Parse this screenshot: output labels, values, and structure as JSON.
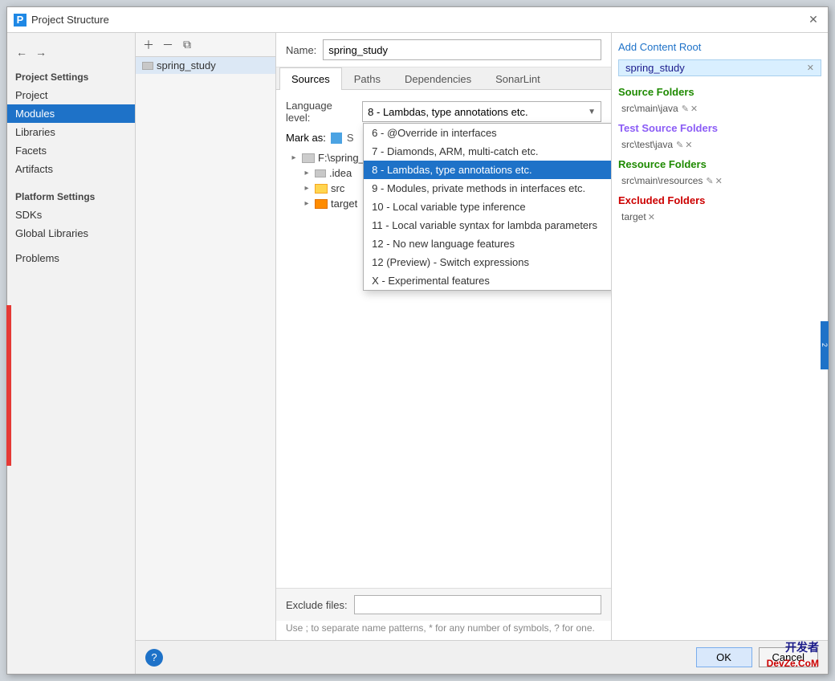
{
  "window": {
    "title": "Project Structure",
    "icon": "P"
  },
  "sidebar": {
    "project_settings_label": "Project Settings",
    "items": [
      {
        "label": "Project",
        "id": "project"
      },
      {
        "label": "Modules",
        "id": "modules",
        "active": true
      },
      {
        "label": "Libraries",
        "id": "libraries"
      },
      {
        "label": "Facets",
        "id": "facets"
      },
      {
        "label": "Artifacts",
        "id": "artifacts"
      }
    ],
    "platform_settings_label": "Platform Settings",
    "platform_items": [
      {
        "label": "SDKs",
        "id": "sdks"
      },
      {
        "label": "Global Libraries",
        "id": "global-libraries"
      }
    ],
    "other_items": [
      {
        "label": "Problems",
        "id": "problems"
      }
    ]
  },
  "module_pane": {
    "module_name": "spring_study"
  },
  "name_row": {
    "label": "Name:",
    "value": "spring_study"
  },
  "tabs": [
    {
      "label": "Sources",
      "id": "sources",
      "active": true
    },
    {
      "label": "Paths",
      "id": "paths"
    },
    {
      "label": "Dependencies",
      "id": "dependencies"
    },
    {
      "label": "SonarLint",
      "id": "sonarlint"
    }
  ],
  "sources": {
    "language_level_label": "Language level:",
    "selected_value": "8 - Lambdas, type annotations etc.",
    "dropdown_items": [
      {
        "label": "6 - @Override in interfaces",
        "selected": false
      },
      {
        "label": "7 - Diamonds, ARM, multi-catch etc.",
        "selected": false
      },
      {
        "label": "8 - Lambdas, type annotations etc.",
        "selected": true
      },
      {
        "label": "9 - Modules, private methods in interfaces etc.",
        "selected": false
      },
      {
        "label": "10 - Local variable type inference",
        "selected": false
      },
      {
        "label": "11 - Local variable syntax for lambda parameters",
        "selected": false
      },
      {
        "label": "12 - No new language features",
        "selected": false
      },
      {
        "label": "12 (Preview) - Switch expressions",
        "selected": false
      },
      {
        "label": "X - Experimental features",
        "selected": false
      }
    ],
    "mark_as_label": "Mark as:",
    "tree": {
      "root_path": "F:\\spring_s...",
      "children": [
        {
          "label": ".idea",
          "level": 1
        },
        {
          "label": "src",
          "level": 1
        },
        {
          "label": "target",
          "level": 1
        }
      ]
    }
  },
  "right_panel": {
    "add_content_root": "Add Content Root",
    "module_tag": "spring_study",
    "sections": [
      {
        "title": "Source Folders",
        "type": "source",
        "paths": [
          "src\\main\\java"
        ]
      },
      {
        "title": "Test Source Folders",
        "type": "test",
        "paths": [
          "src\\test\\java"
        ]
      },
      {
        "title": "Resource Folders",
        "type": "resource",
        "paths": [
          "src\\main\\resources"
        ]
      },
      {
        "title": "Excluded Folders",
        "type": "excluded",
        "paths": [
          "target"
        ]
      }
    ]
  },
  "exclude_row": {
    "label": "Exclude files:",
    "hint": "Use ; to separate name patterns, * for any number of symbols, ? for one."
  },
  "bottom_bar": {
    "ok_label": "OK",
    "cancel_label": "Cancel"
  },
  "watermark": "开发者\nDevZe.CoM"
}
